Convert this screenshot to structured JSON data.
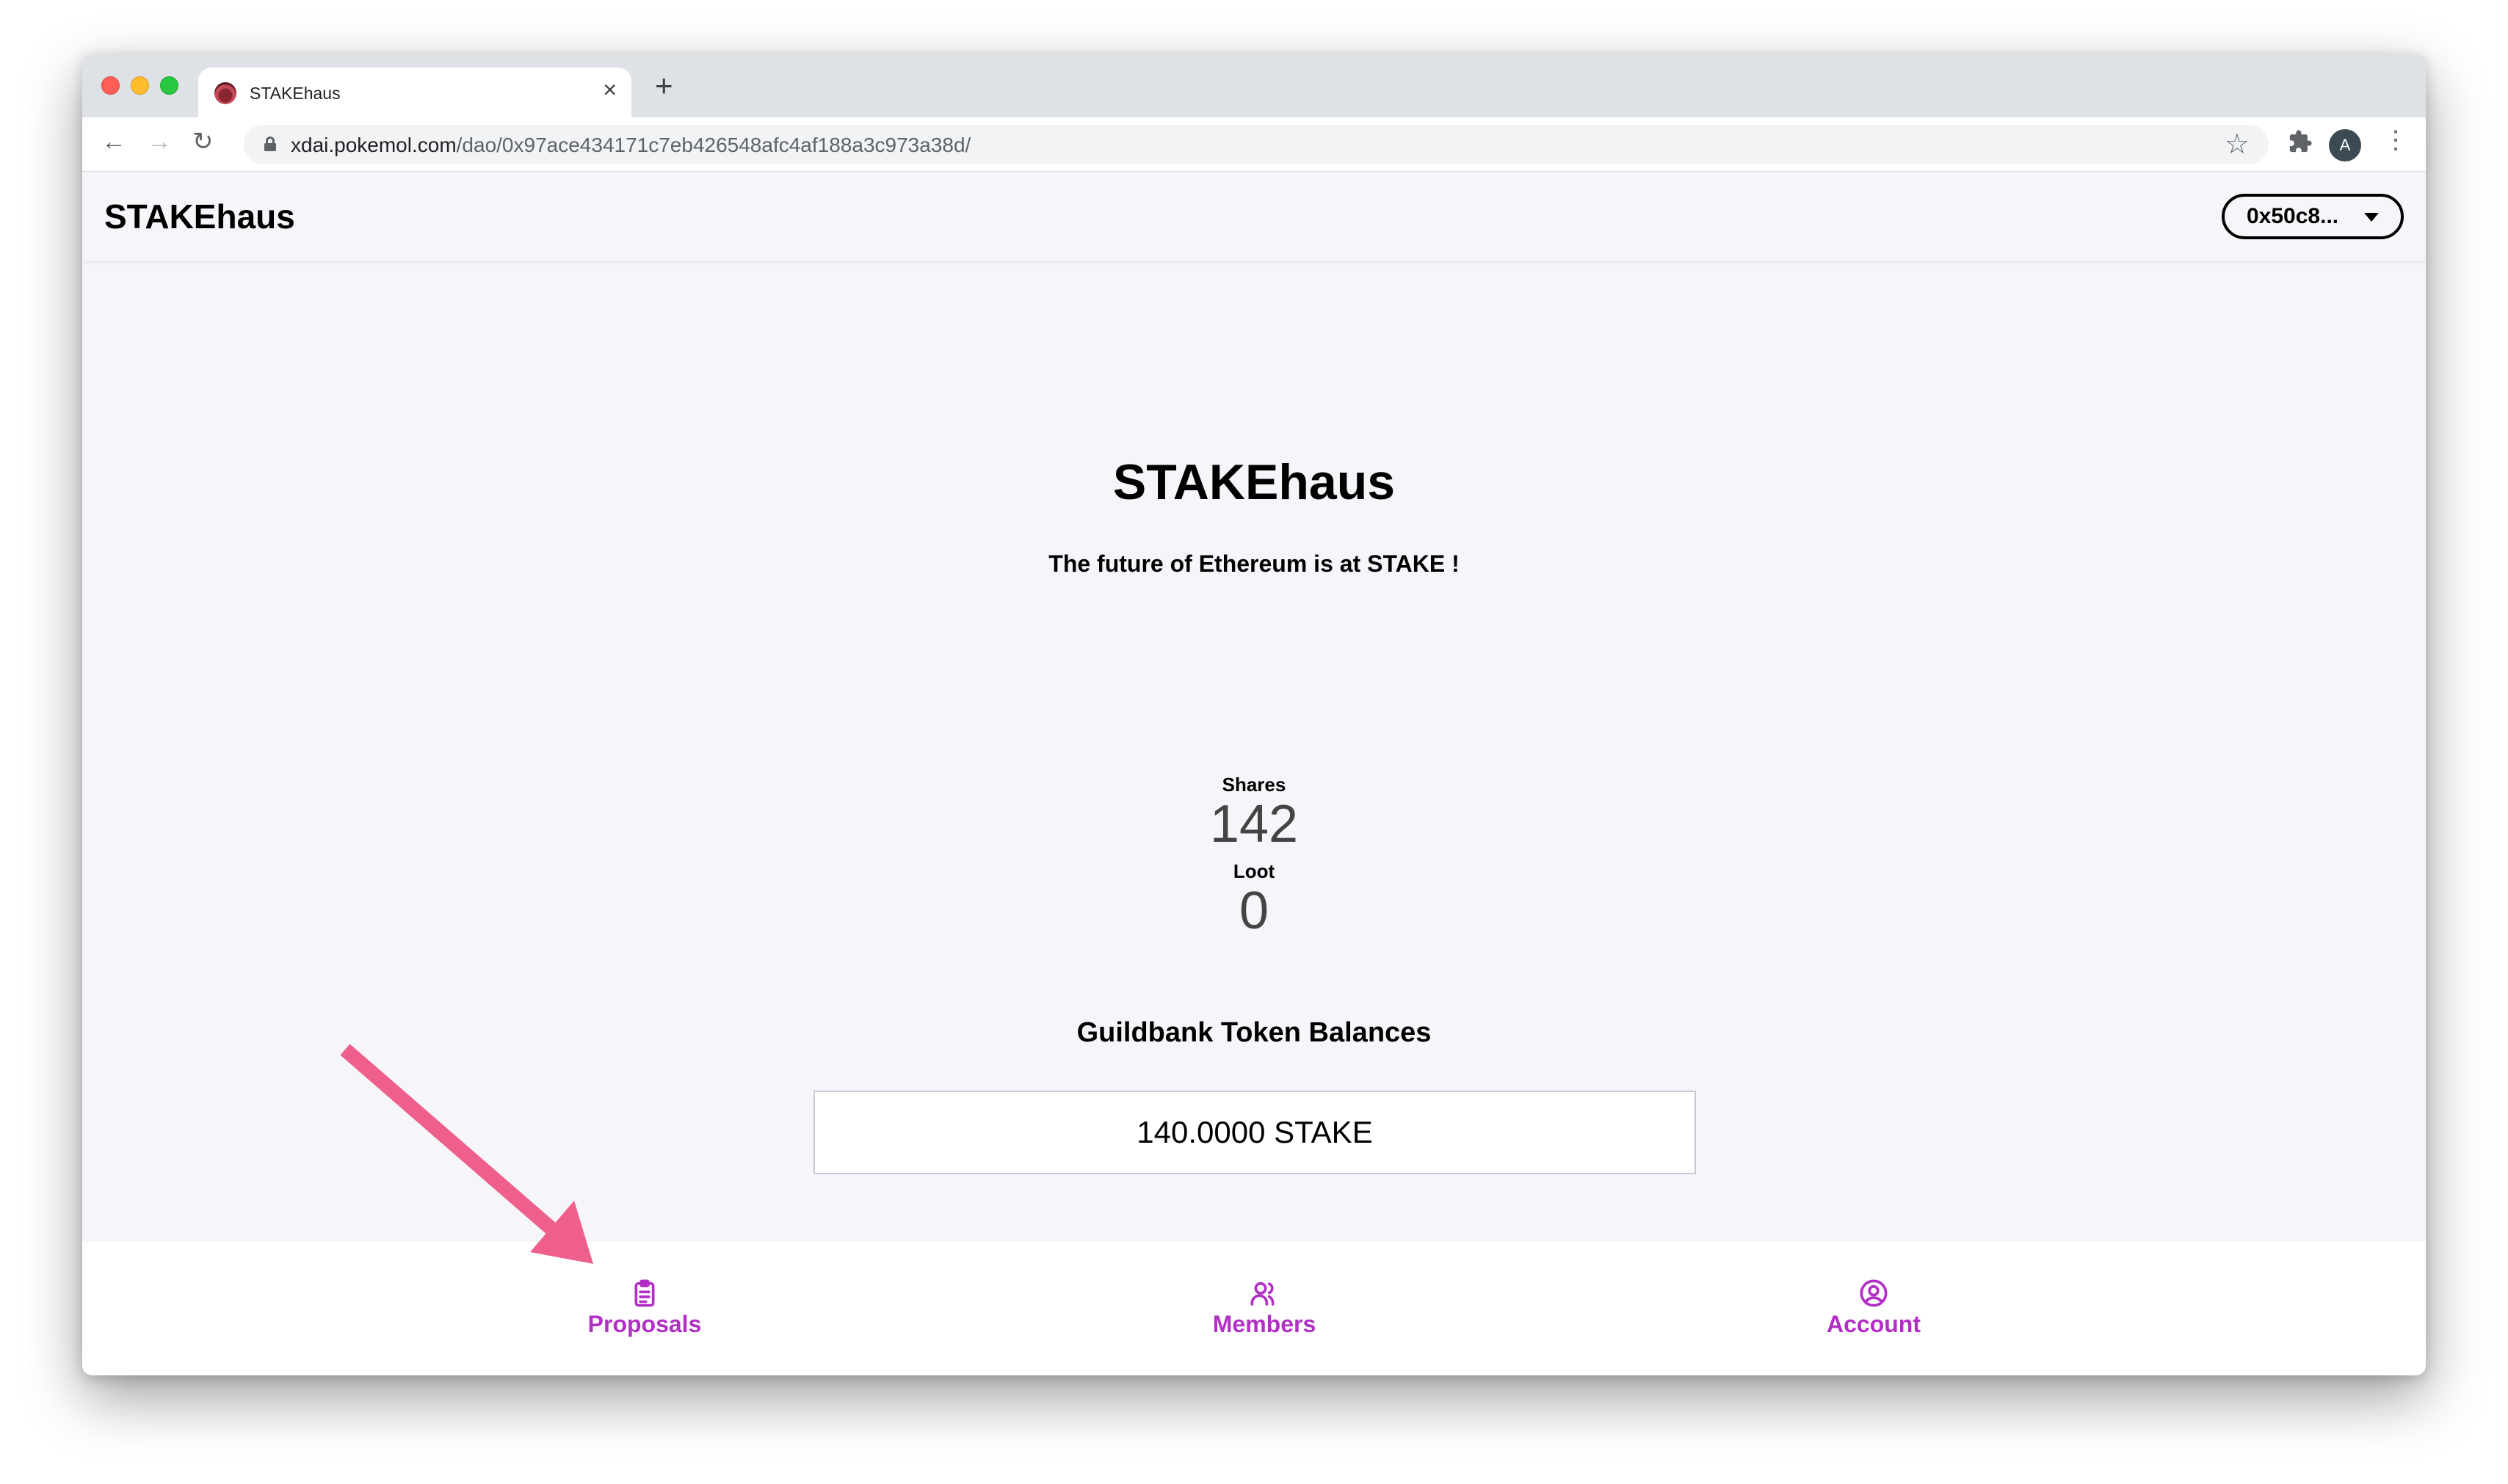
{
  "browser": {
    "tab_title": "STAKEhaus",
    "url_host": "xdai.pokemol.com",
    "url_path": "/dao/0x97ace434171c7eb426548afc4af188a3c973a38d/",
    "profile_initial": "A"
  },
  "header": {
    "brand": "STAKEhaus",
    "account_label": "0x50c8..."
  },
  "dao": {
    "title": "STAKEhaus",
    "tagline": "The future of Ethereum is at STAKE !"
  },
  "stats": {
    "shares_label": "Shares",
    "shares_value": "142",
    "loot_label": "Loot",
    "loot_value": "0"
  },
  "guildbank": {
    "title": "Guildbank Token Balances",
    "balance": "140.0000 STAKE"
  },
  "bottom_nav": {
    "items": [
      {
        "label": "Proposals",
        "icon": "clipboard-icon"
      },
      {
        "label": "Members",
        "icon": "users-icon"
      },
      {
        "label": "Account",
        "icon": "user-circle-icon"
      }
    ]
  },
  "colors": {
    "accent": "#b22fc5",
    "annotation_arrow": "#ef5f8c"
  }
}
